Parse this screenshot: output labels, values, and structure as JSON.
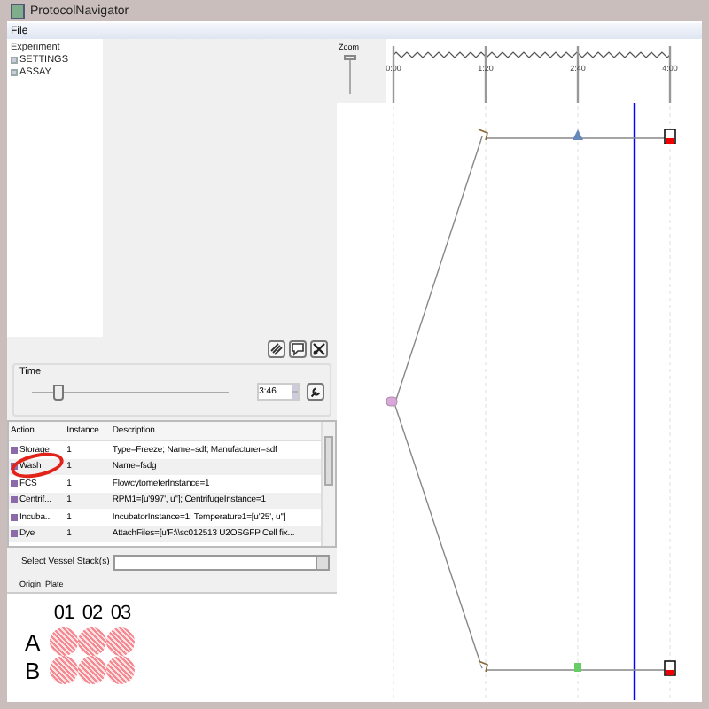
{
  "window": {
    "title": "ProtocolNavigator"
  },
  "menu": [
    "File"
  ],
  "tree": [
    {
      "label": "Experiment",
      "children": [
        {
          "label": "SETTINGS"
        },
        {
          "label": "ASSAY"
        }
      ]
    }
  ],
  "time": {
    "label": "Time",
    "level": 0.13,
    "value": "3:46"
  },
  "table": {
    "columns": [
      "Action",
      "Instance ...",
      "Description"
    ],
    "rows": [
      {
        "action": "Storage",
        "instance": "1",
        "description": "Type=Freeze; Name=sdf; Manufacturer=sdf"
      },
      {
        "action": "Wash",
        "instance": "1",
        "description": "Name=fsdg"
      },
      {
        "action": "FCS",
        "instance": "1",
        "description": "FlowcytometerInstance=1"
      },
      {
        "action": "Centrif...",
        "instance": "1",
        "description": "RPM1=[u'997', u'']; CentrifugeInstance=1"
      },
      {
        "action": "Incuba...",
        "instance": "1",
        "description": "IncubatorInstance=1; Temperature1=[u'25', u'']"
      },
      {
        "action": "Dye",
        "instance": "1",
        "description": "AttachFiles=[u'F:\\\\sc012513 U2OSGFP Cell fix..."
      }
    ]
  },
  "vessel_select": {
    "label": "Select Vessel Stack(s)"
  },
  "plate": {
    "title": "Origin_Plate",
    "columns": [
      "01",
      "02",
      "03"
    ],
    "rows": [
      "A",
      "B"
    ]
  },
  "timeline": {
    "zoom": {
      "label": "Zoom",
      "level": 1
    },
    "ticks": [
      "0:00",
      "1:20",
      "2:40",
      "4:00"
    ]
  }
}
